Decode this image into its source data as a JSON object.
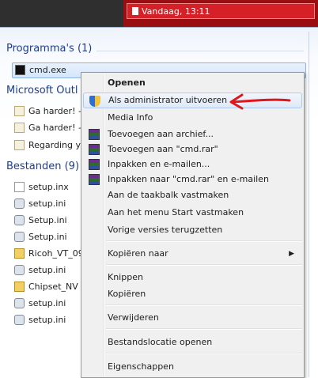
{
  "notification": {
    "text": "Vandaag, 13:11",
    "icon": "document-icon"
  },
  "sections": {
    "programs": {
      "title": "Programma's (1)",
      "items": [
        {
          "label": "cmd.exe",
          "icon": "cmd-icon"
        }
      ]
    },
    "outlook": {
      "title": "Microsoft Outl",
      "items": [
        {
          "label": "Ga harder! -",
          "icon": "mail-icon"
        },
        {
          "label": "Ga harder! -",
          "icon": "mail-icon"
        },
        {
          "label": "Regarding y",
          "icon": "mail-icon"
        }
      ]
    },
    "files": {
      "title": "Bestanden (9)",
      "items": [
        {
          "label": "setup.inx",
          "icon": "text-file-icon"
        },
        {
          "label": "setup.ini",
          "icon": "settings-file-icon"
        },
        {
          "label": "Setup.ini",
          "icon": "settings-file-icon"
        },
        {
          "label": "Setup.ini",
          "icon": "settings-file-icon"
        },
        {
          "label": "Ricoh_VT_09",
          "icon": "folder-icon"
        },
        {
          "label": "setup.ini",
          "icon": "settings-file-icon"
        },
        {
          "label": "Chipset_NV",
          "icon": "folder-icon"
        },
        {
          "label": "setup.ini",
          "icon": "settings-file-icon"
        },
        {
          "label": "setup.ini",
          "icon": "settings-file-icon"
        }
      ]
    }
  },
  "context_menu": {
    "open": "Openen",
    "run_as_admin": "Als administrator uitvoeren",
    "media_info": "Media Info",
    "add_archive": "Toevoegen aan archief...",
    "add_cmd_rar": "Toevoegen aan \"cmd.rar\"",
    "pack_email": "Inpakken en e-mailen...",
    "pack_cmd_rar_email": "Inpakken naar \"cmd.rar\" en e-mailen",
    "pin_taskbar": "Aan de taakbalk vastmaken",
    "pin_start": "Aan het menu Start vastmaken",
    "restore_versions": "Vorige versies terugzetten",
    "copy_to": "Kopiëren naar",
    "cut": "Knippen",
    "copy": "Kopiëren",
    "delete": "Verwijderen",
    "open_location": "Bestandslocatie openen",
    "properties": "Eigenschappen"
  },
  "colors": {
    "annotation_arrow": "#e0161b",
    "notification_bg": "#d52027",
    "section_title": "#1e3d8f"
  }
}
